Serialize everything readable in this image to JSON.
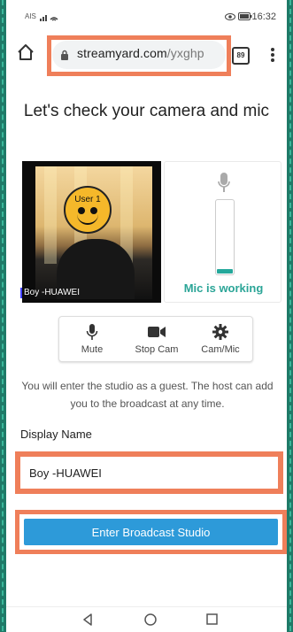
{
  "status_bar": {
    "left": "AIS",
    "time": "16:32"
  },
  "browser": {
    "url_domain": "streamyard.com",
    "url_path": "/yxghp",
    "tab_count": "89"
  },
  "headline": "Let's check your camera and mic",
  "camera": {
    "overlay_label": "User 1",
    "name_label": "Boy -HUAWEI"
  },
  "mic": {
    "status": "Mic is working",
    "level": 0.06
  },
  "controls": {
    "mute": "Mute",
    "stop_cam": "Stop Cam",
    "cam_mic": "Cam/Mic"
  },
  "info_text": "You will enter the studio as a guest. The host can add you to the broadcast at any time.",
  "display_name": {
    "label": "Display Name",
    "value": "Boy -HUAWEI"
  },
  "enter_button": "Enter Broadcast Studio",
  "colors": {
    "accent": "#2d9ad9",
    "mic_ok": "#2ba597",
    "highlight": "#ef7f5a"
  }
}
